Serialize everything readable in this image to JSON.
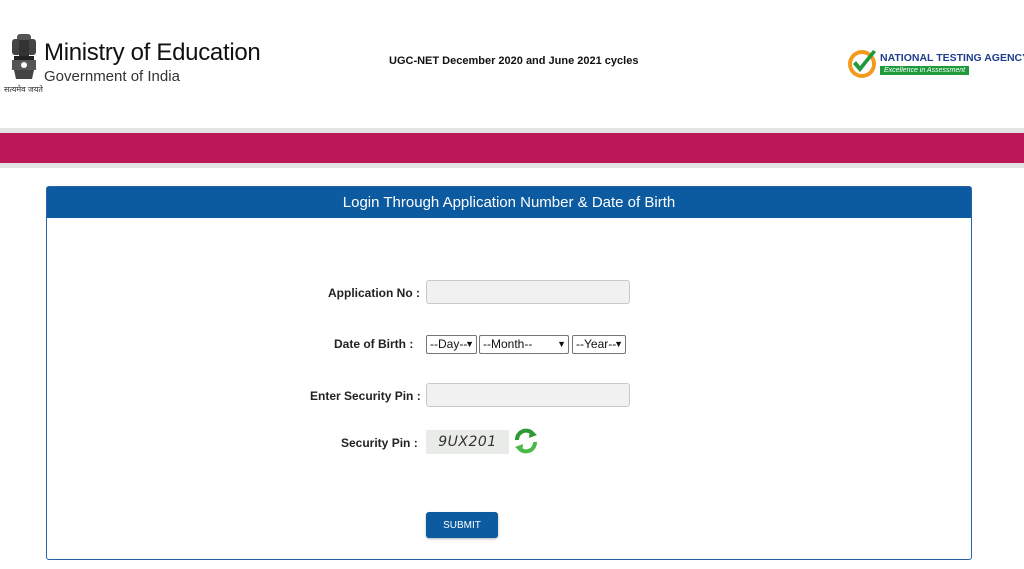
{
  "header": {
    "ministry_title": "Ministry of Education",
    "ministry_subtitle": "Government of India",
    "emblem_caption": "सत्यमेव जयते",
    "exam_cycle_title": "UGC-NET December 2020 and June 2021 cycles",
    "agency_name": "NATIONAL TESTING AGENCY",
    "agency_tagline": "Excellence in Assessment"
  },
  "colors": {
    "band": "#bc1757",
    "panel_header": "#0c5aa0",
    "agency_green": "#1e9a3d",
    "agency_blue": "#1f3f8c"
  },
  "login": {
    "panel_title": "Login Through Application Number & Date of Birth",
    "application_no_label": "Application No :",
    "application_no_value": "",
    "dob_label": "Date of Birth :",
    "day_selected": "--Day--",
    "month_selected": "--Month--",
    "year_selected": "--Year--",
    "security_pin_input_label": "Enter Security Pin :",
    "security_pin_value": "",
    "security_pin_label": "Security Pin :",
    "captcha_text": "9UX201",
    "refresh_icon": "refresh-icon",
    "submit_label": "SUBMIT"
  }
}
